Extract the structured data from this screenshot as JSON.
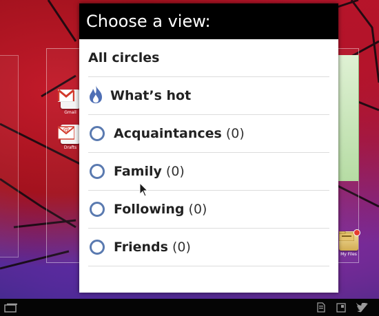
{
  "dialog": {
    "title": "Choose a view:",
    "items": [
      {
        "label": "All circles",
        "count": "",
        "icon": "none"
      },
      {
        "label": "What’s hot",
        "count": "",
        "icon": "flame-icon"
      },
      {
        "label": "Acquaintances",
        "count": "(0)",
        "icon": "circle-icon"
      },
      {
        "label": "Family",
        "count": "(0)",
        "icon": "circle-icon"
      },
      {
        "label": "Following",
        "count": "(0)",
        "icon": "circle-icon"
      },
      {
        "label": "Friends",
        "count": "(0)",
        "icon": "circle-icon"
      }
    ]
  },
  "desktop": {
    "icons": [
      {
        "label": "Gmail",
        "icon": "gmail-icon"
      },
      {
        "label": "Drafts",
        "icon": "drafts-icon"
      },
      {
        "label": "My Files",
        "icon": "folder-icon"
      }
    ]
  },
  "navbar": {
    "icons": [
      "recent-apps-icon",
      "sd-card-icon",
      "screenshot-icon",
      "twitter-icon"
    ]
  },
  "colors": {
    "dialog_header": "#000000",
    "circle_ring": "#5a7ab0",
    "flame": "#4f6fb5"
  }
}
